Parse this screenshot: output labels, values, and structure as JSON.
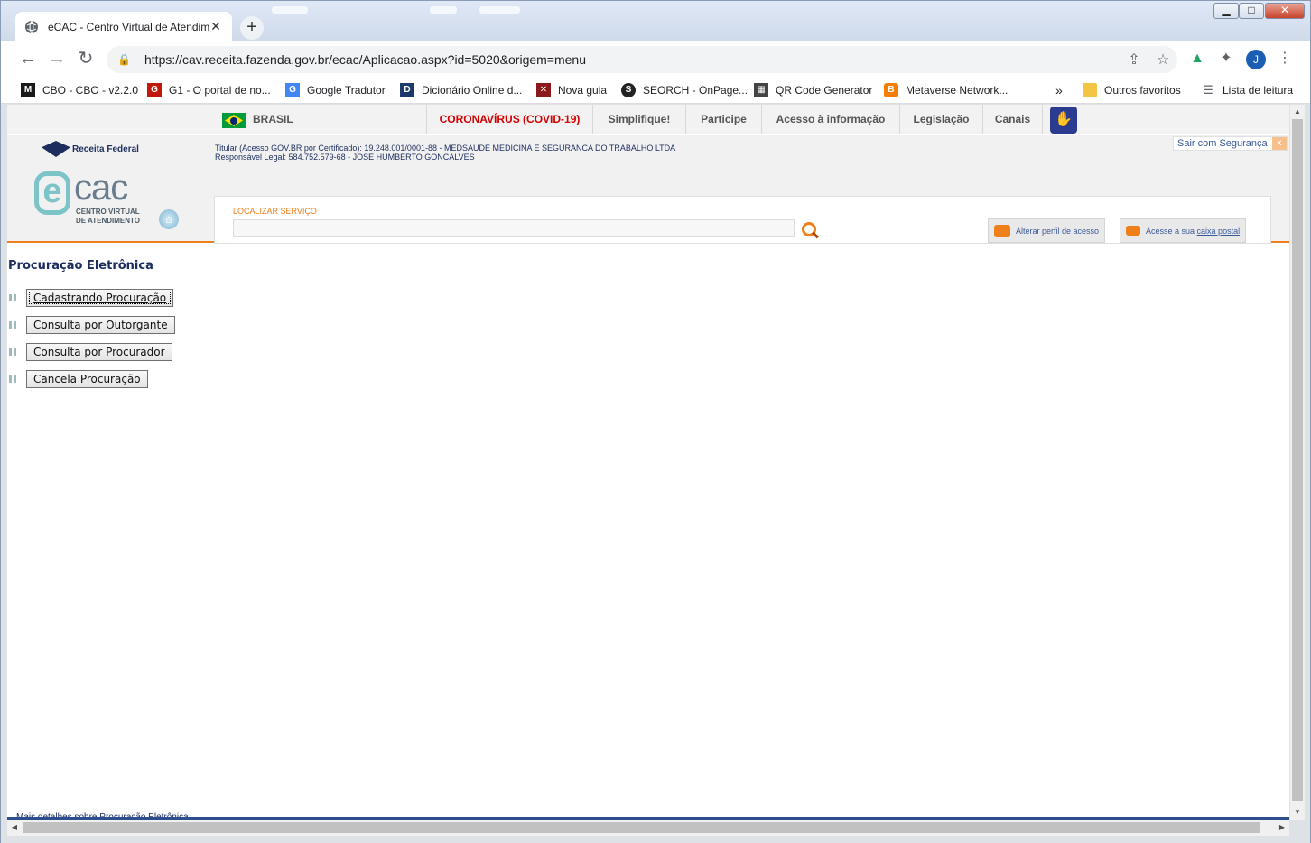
{
  "browser": {
    "tab_title": "eCAC - Centro Virtual de Atendimento",
    "tab_close": "✕",
    "new_tab": "+",
    "url": "https://cav.receita.fazenda.gov.br/ecac/Aplicacao.aspx?id=5020&origem=menu",
    "window_controls": {
      "minimize": "▁",
      "maximize": "□",
      "close": "✕"
    },
    "profile_initial": "J",
    "bookmarks": [
      {
        "label": "CBO - CBO - v2.2.0",
        "icon": "mte-icon",
        "color": "#1a1a1a"
      },
      {
        "label": "G1 - O portal de no...",
        "icon": "g1-icon",
        "color": "#c4170c"
      },
      {
        "label": "Google Tradutor",
        "icon": "translate-icon",
        "color": "#4285f4"
      },
      {
        "label": "Dicionário Online d...",
        "icon": "dictionary-icon",
        "color": "#1a3a6b"
      },
      {
        "label": "Nova guia",
        "icon": "newtab-icon",
        "color": "#8b1a1a"
      },
      {
        "label": "SEORCH - OnPage...",
        "icon": "seorch-icon",
        "color": "#222222"
      },
      {
        "label": "QR Code Generator",
        "icon": "qrcode-icon",
        "color": "#444444"
      },
      {
        "label": "Metaverse Network...",
        "icon": "blogger-icon",
        "color": "#f57d00"
      }
    ],
    "bookmarks_overflow": "»",
    "other_favorites": "Outros favoritos",
    "reading_list": "Lista de leitura"
  },
  "gov_bar": {
    "country": "BRASIL",
    "links": [
      "CORONAVÍRUS (COVID-19)",
      "Simplifique!",
      "Participe",
      "Acesso à informação",
      "Legislação",
      "Canais"
    ]
  },
  "header": {
    "agency": "Receita Federal",
    "ecac_letter": "e",
    "ecac_text": "cac",
    "ecac_subtitle_1": "CENTRO VIRTUAL",
    "ecac_subtitle_2": "DE ATENDIMENTO",
    "holder_line": "Titular (Acesso GOV.BR por Certificado): 19.248.001/0001-88 - MEDSAUDE MEDICINA E SEGURANCA DO TRABALHO LTDA",
    "legal_line": "Responsável Legal: 584.752.579-68 - JOSE HUMBERTO GONCALVES",
    "exit_label": "Sair com Segurança",
    "exit_x": "x",
    "search_label": "LOCALIZAR SERVIÇO",
    "search_value": "",
    "profile_button": "Alterar perfil de acesso",
    "mailbox_prefix": "Acesse a sua ",
    "mailbox_link": "caixa postal"
  },
  "main": {
    "title": "Procuração Eletrônica",
    "actions": [
      "Cadastrando Procuração",
      "Consulta por Outorgante",
      "Consulta por Procurador",
      "Cancela Procuração"
    ],
    "footer_text": "Mais detalhes sobre Procuração Eletrônica"
  },
  "colors": {
    "accent_orange": "#ef7f1a",
    "navy": "#1c2d5e",
    "covid_red": "#d40000"
  }
}
